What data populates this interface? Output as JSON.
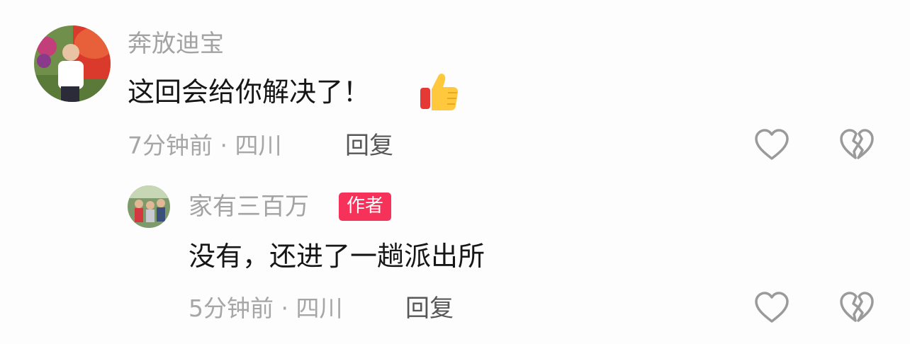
{
  "comments": [
    {
      "username": "奔放迪宝",
      "text": "这回会给你解决了！",
      "emoji": "thumbs-up",
      "meta": "7分钟前 · 四川",
      "reply_label": "回复"
    }
  ],
  "reply": {
    "username": "家有三百万",
    "badge": "作者",
    "text": "没有，还进了一趟派出所",
    "meta": "5分钟前 · 四川",
    "reply_label": "回复"
  },
  "colors": {
    "badge": "#f6315a",
    "username": "#a3a3a3",
    "text": "#161616",
    "meta": "#a6a6a6",
    "icon": "#9a9a9a"
  }
}
